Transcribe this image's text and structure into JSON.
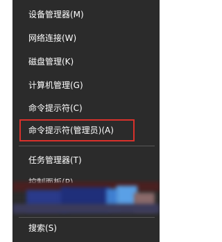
{
  "menu": {
    "items": [
      {
        "label": "设备管理器(M)"
      },
      {
        "label": "网络连接(W)"
      },
      {
        "label": "磁盘管理(K)"
      },
      {
        "label": "计算机管理(G)"
      },
      {
        "label": "命令提示符(C)"
      },
      {
        "label": "命令提示符(管理员)(A)"
      },
      {
        "label": "任务管理器(T)"
      },
      {
        "label": "控制面板(P)"
      },
      {
        "label": "搜索(S)"
      }
    ],
    "highlight_color": "#d9312b",
    "background_color": "#2b2b2b"
  }
}
